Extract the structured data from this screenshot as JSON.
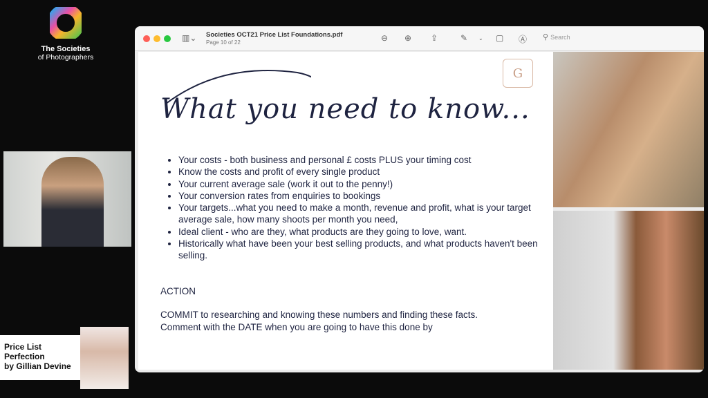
{
  "brand": {
    "line1": "The Societies",
    "line2": "of Photographers"
  },
  "lower_third": {
    "line1": "Price List",
    "line2": "Perfection",
    "line3": "by Gillian Devine"
  },
  "viewer": {
    "title": "Societies OCT21 Price List Foundations.pdf",
    "page_info": "Page 10 of 22",
    "search_placeholder": "Search",
    "window_colors": {
      "close": "#fe5f57",
      "minimize": "#febc2e",
      "maximize": "#28c840"
    }
  },
  "slide": {
    "heading": "What you need to know...",
    "crest_letter": "G",
    "bullets": [
      "Your costs - both business and personal £ costs PLUS your timing cost",
      "Know the costs and profit of every single product",
      "Your current average sale (work it out to the penny!)",
      "Your conversion rates from enquiries to bookings",
      "Your targets...what you need to make a month, revenue and profit, what is your target average sale, how many shoots per month you need,",
      "Ideal client - who are they, what products are they going to love, want.",
      "Historically what have been your best selling products, and what products haven't been selling."
    ],
    "action_title": "ACTION",
    "action_line1": "COMMIT to researching and knowing these numbers and finding these facts.",
    "action_line2": "Comment with the DATE when you are going to have this done by"
  }
}
